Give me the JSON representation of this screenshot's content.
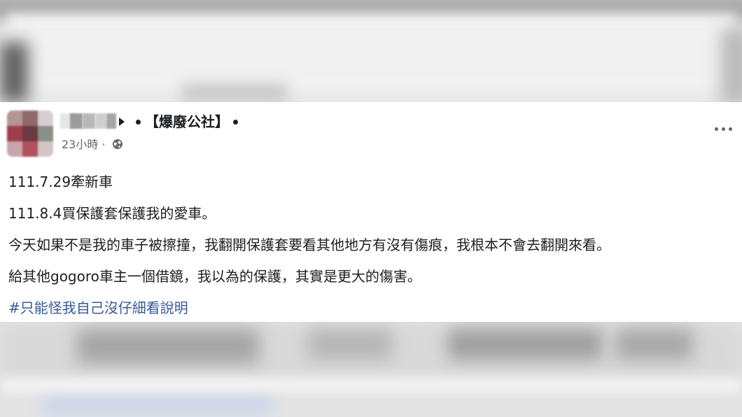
{
  "post": {
    "group_name": "【爆廢公社】",
    "timestamp": "23小時",
    "meta_separator": "·",
    "privacy_icon": "globe-icon",
    "more_icon": "more-horizontal-icon",
    "lines": [
      "111.7.29牽新車",
      "111.8.4買保護套保護我的愛車。",
      "今天如果不是我的車子被擦撞，我翻開保護套要看其他地方有沒有傷痕，我根本不會去翻開來看。",
      "給其他gogoro車主一個借鏡，我以為的保護，其實是更大的傷害。"
    ],
    "hashtag": "#只能怪我自己沒仔細看說明"
  },
  "colors": {
    "text": "#1c1e21",
    "meta": "#65676b",
    "hashtag": "#385898"
  }
}
